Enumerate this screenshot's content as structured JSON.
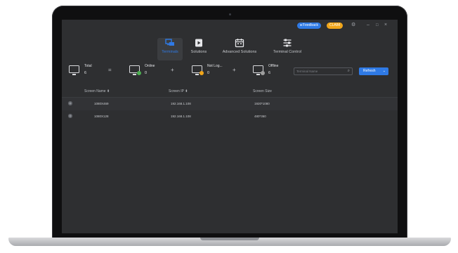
{
  "titlebar": {
    "feedback_label": "Feedback",
    "account_badge": "CLAIM",
    "icons": [
      "gear-icon",
      "minimize-icon",
      "maximize-icon",
      "close-icon"
    ]
  },
  "nav": {
    "tabs": [
      {
        "label": "Terminals",
        "icon": "monitors-icon",
        "active": true
      },
      {
        "label": "Solutions",
        "icon": "play-icon",
        "active": false
      },
      {
        "label": "Advanced Solutions",
        "icon": "calendar-icon",
        "active": false
      },
      {
        "label": "Terminal Control",
        "icon": "sliders-icon",
        "active": false
      }
    ]
  },
  "stats": {
    "total": {
      "label": "Total",
      "value": "6"
    },
    "online": {
      "label": "Online",
      "value": "0",
      "status_color": "#4caf50"
    },
    "not_logged": {
      "label": "Not Log...",
      "value": "0",
      "status_color": "#f0a51a"
    },
    "offline": {
      "label": "Offline",
      "value": "6",
      "status_color": "#9e9e9e"
    },
    "operators": {
      "eq": "=",
      "plus1": "+",
      "plus2": "+"
    }
  },
  "search": {
    "placeholder": "Terminal Name"
  },
  "refresh": {
    "label": "Refresh"
  },
  "table": {
    "headers": [
      "Screen Name",
      "Screen IP",
      "Screen Size"
    ],
    "rows": [
      {
        "name": "1080X469",
        "ip": "192.168.1.108",
        "size": "1920*1080"
      },
      {
        "name": "1080X128",
        "ip": "192.168.1.108",
        "size": "480*360"
      }
    ]
  },
  "colors": {
    "accent": "#2f7ae5",
    "background": "#2e2f31"
  }
}
